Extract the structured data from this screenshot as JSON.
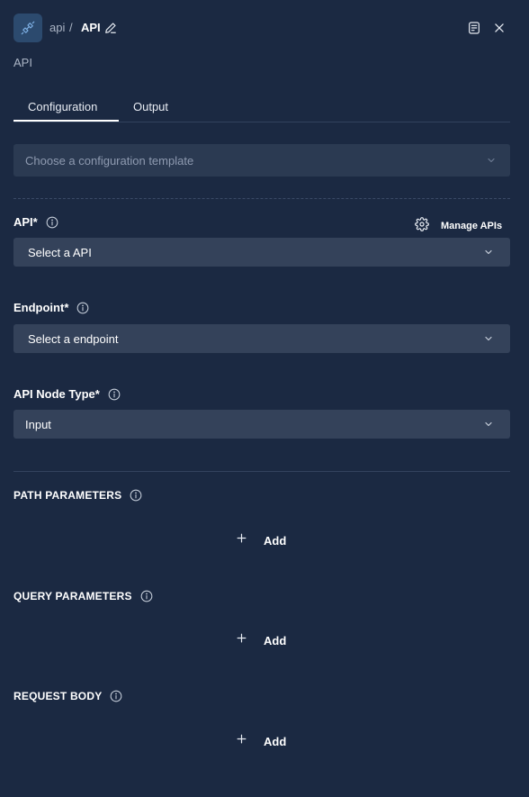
{
  "header": {
    "breadcrumb_parent": "api",
    "breadcrumb_separator": "/",
    "title": "API",
    "subtitle": "API",
    "icon_name": "api-plug-icon"
  },
  "tabs": [
    {
      "label": "Configuration",
      "active": true
    },
    {
      "label": "Output",
      "active": false
    }
  ],
  "template_select": {
    "placeholder": "Choose a configuration template"
  },
  "fields": {
    "api": {
      "label": "API",
      "required_mark": "*",
      "value": "Select a API"
    },
    "manage_apis_label": "Manage APIs",
    "endpoint": {
      "label": "Endpoint*",
      "value": "Select a endpoint"
    },
    "node_type": {
      "label": "API Node Type*",
      "value": "Input"
    }
  },
  "sections": {
    "path_params": {
      "label": "PATH PARAMETERS",
      "add_label": "Add"
    },
    "query_params": {
      "label": "QUERY PARAMETERS",
      "add_label": "Add"
    },
    "request_body": {
      "label": "REQUEST BODY",
      "add_label": "Add"
    }
  },
  "colors": {
    "background": "#1b2942",
    "input_bg": "#34425a",
    "accent_icon_bg": "#2c4a6e",
    "accent_icon_fg": "#7fb2e6"
  }
}
